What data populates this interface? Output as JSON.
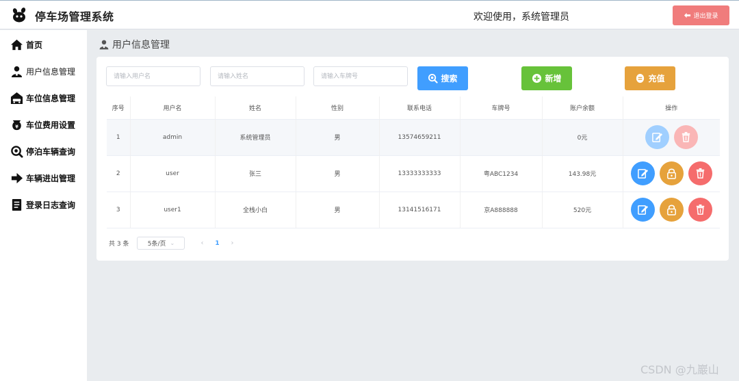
{
  "header": {
    "title": "停车场管理系统",
    "welcome": "欢迎使用，系统管理员",
    "logout_label": "退出登录"
  },
  "sidebar": {
    "items": [
      {
        "label": "首页",
        "icon": "home-icon"
      },
      {
        "label": "用户信息管理",
        "icon": "user-icon"
      },
      {
        "label": "车位信息管理",
        "icon": "parking-icon"
      },
      {
        "label": "车位费用设置",
        "icon": "fee-icon"
      },
      {
        "label": "停泊车辆查询",
        "icon": "search-icon"
      },
      {
        "label": "车辆进出管理",
        "icon": "arrow-right-icon"
      },
      {
        "label": "登录日志查询",
        "icon": "log-icon"
      }
    ]
  },
  "page": {
    "title": "用户信息管理"
  },
  "search": {
    "username_placeholder": "请输入用户名",
    "name_placeholder": "请输入姓名",
    "plate_placeholder": "请输入车牌号",
    "search_label": "搜索",
    "add_label": "新增",
    "recharge_label": "充值"
  },
  "table": {
    "headers": [
      "序号",
      "用户名",
      "姓名",
      "性别",
      "联系电话",
      "车牌号",
      "账户余额",
      "操作"
    ],
    "rows": [
      {
        "index": "1",
        "username": "admin",
        "name": "系统管理员",
        "gender": "男",
        "phone": "13574659211",
        "plate": "",
        "balance": "0元"
      },
      {
        "index": "2",
        "username": "user",
        "name": "张三",
        "gender": "男",
        "phone": "13333333333",
        "plate": "粤ABC1234",
        "balance": "143.98元"
      },
      {
        "index": "3",
        "username": "user1",
        "name": "全栈小白",
        "gender": "男",
        "phone": "13141516171",
        "plate": "京A888888",
        "balance": "520元"
      }
    ]
  },
  "pagination": {
    "total": "共 3 条",
    "page_size": "5条/页",
    "current_page": "1"
  },
  "colors": {
    "primary": "#409eff",
    "success": "#67c23a",
    "warning": "#e6a23c",
    "danger": "#f56c6c"
  },
  "watermark": "CSDN @九巖山"
}
